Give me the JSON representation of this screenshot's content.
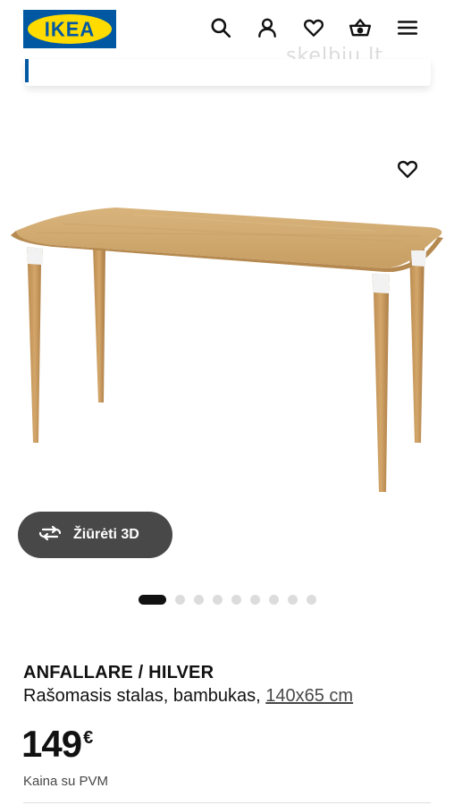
{
  "header": {
    "logo_text": "IKEA",
    "icons": [
      "search-icon",
      "user-icon",
      "heart-icon",
      "basket-icon",
      "menu-icon"
    ]
  },
  "watermark": {
    "text": "skelbiu.lt"
  },
  "gallery": {
    "view_3d_label": "Žiūrėti 3D",
    "image_count": 9,
    "active_index": 0
  },
  "product": {
    "name": "ANFALLARE / HILVER",
    "description": "Rašomasis stalas, bambukas,",
    "dimensions": "140x65 cm",
    "price": "149",
    "currency": "€",
    "price_note": "Kaina su PVM"
  },
  "colors": {
    "ikea_blue": "#0058a3",
    "ikea_yellow": "#ffdb00",
    "button_dark": "#484848",
    "text": "#111111"
  }
}
